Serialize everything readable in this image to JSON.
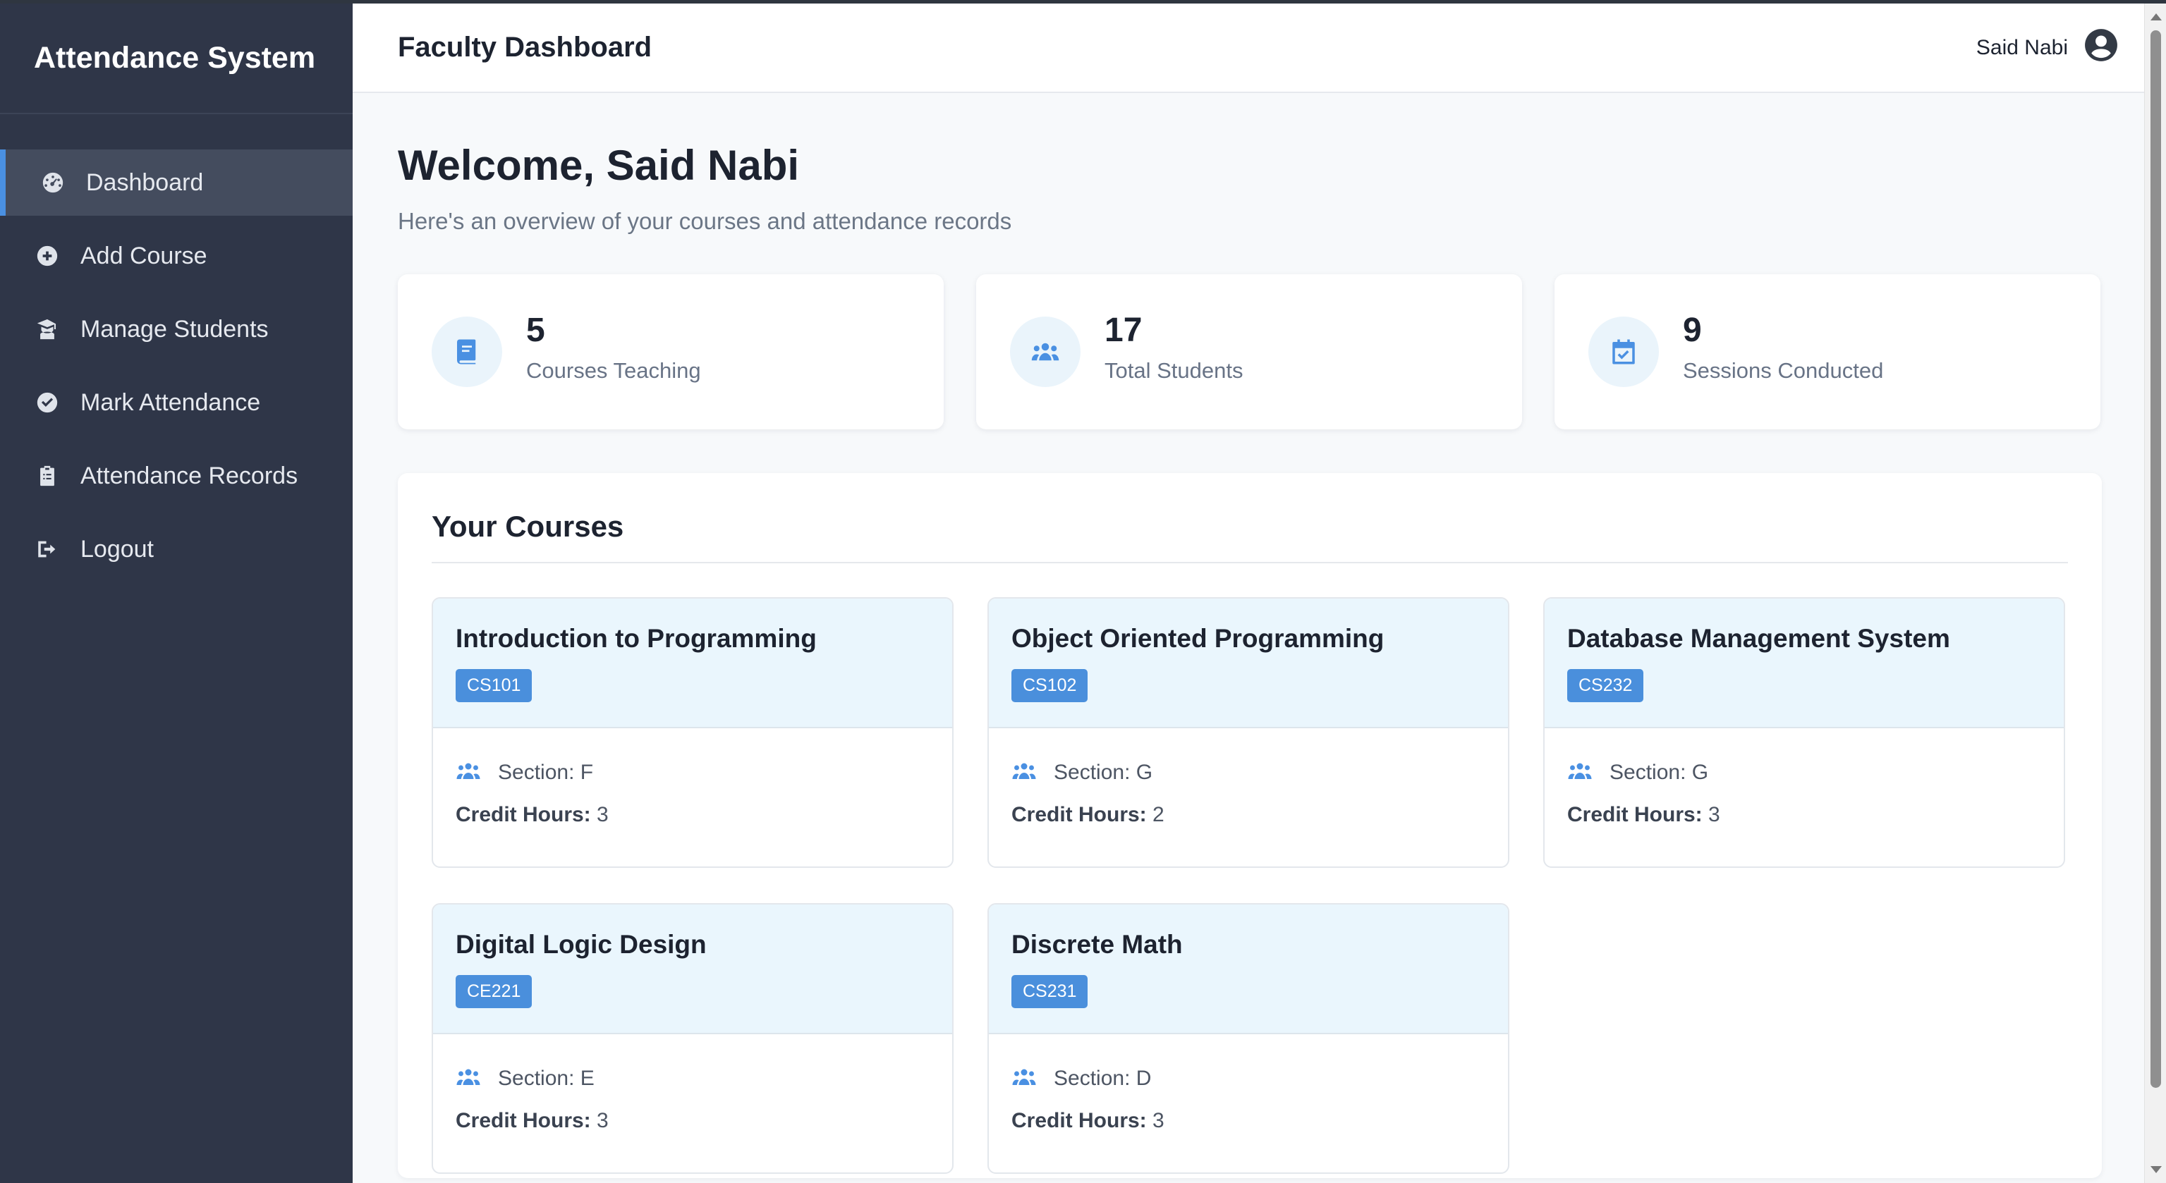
{
  "app": {
    "brand": "Attendance System"
  },
  "sidebar": {
    "items": [
      {
        "label": "Dashboard",
        "icon": "dashboard-gauge-icon",
        "active": true
      },
      {
        "label": "Add Course",
        "icon": "plus-circle-icon",
        "active": false
      },
      {
        "label": "Manage Students",
        "icon": "graduate-icon",
        "active": false
      },
      {
        "label": "Mark Attendance",
        "icon": "check-circle-icon",
        "active": false
      },
      {
        "label": "Attendance Records",
        "icon": "clipboard-icon",
        "active": false
      },
      {
        "label": "Logout",
        "icon": "logout-icon",
        "active": false
      }
    ]
  },
  "header": {
    "title": "Faculty Dashboard",
    "user_name": "Said Nabi",
    "avatar_icon": "user-circle-icon"
  },
  "main": {
    "welcome": "Welcome, Said Nabi",
    "subtitle": "Here's an overview of your courses and attendance records"
  },
  "stats": [
    {
      "value": "5",
      "label": "Courses Teaching",
      "icon": "book-icon"
    },
    {
      "value": "17",
      "label": "Total Students",
      "icon": "users-icon"
    },
    {
      "value": "9",
      "label": "Sessions Conducted",
      "icon": "calendar-check-icon"
    }
  ],
  "courses": {
    "title": "Your Courses",
    "section_prefix": "Section:",
    "credit_label": "Credit Hours:",
    "items": [
      {
        "name": "Introduction to Programming",
        "code": "CS101",
        "section": "F",
        "credit_hours": "3"
      },
      {
        "name": "Object Oriented Programming",
        "code": "CS102",
        "section": "G",
        "credit_hours": "2"
      },
      {
        "name": "Database Management System",
        "code": "CS232",
        "section": "G",
        "credit_hours": "3"
      },
      {
        "name": "Digital Logic Design",
        "code": "CE221",
        "section": "E",
        "credit_hours": "3"
      },
      {
        "name": "Discrete Math",
        "code": "CS231",
        "section": "D",
        "credit_hours": "3"
      }
    ]
  },
  "colors": {
    "sidebar_bg": "#2f3648",
    "accent": "#4a90e2",
    "card_header_bg": "#eaf6fd"
  }
}
